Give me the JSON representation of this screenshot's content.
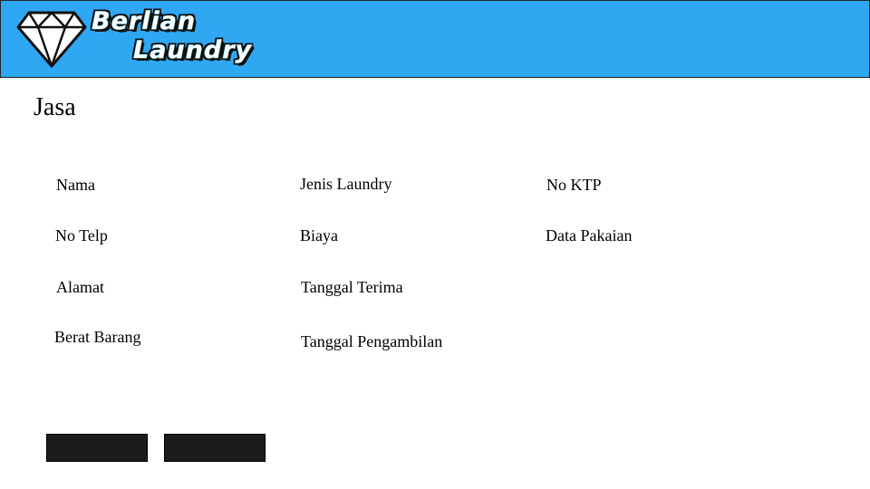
{
  "header": {
    "logo_line1": "Berlian",
    "logo_line2": "Laundry",
    "logo_icon": "diamond-icon",
    "bg_color": "#2fa8f4"
  },
  "page": {
    "title": "Jasa"
  },
  "form": {
    "col1": [
      "Nama",
      "No Telp",
      "Alamat",
      "Berat Barang"
    ],
    "col2": [
      "Jenis Laundry",
      "Biaya",
      "Tanggal Terima",
      "Tanggal Pengambilan"
    ],
    "col3": [
      "No KTP",
      "Data Pakaian"
    ]
  },
  "buttons": {
    "color": "#1b1b1b"
  }
}
